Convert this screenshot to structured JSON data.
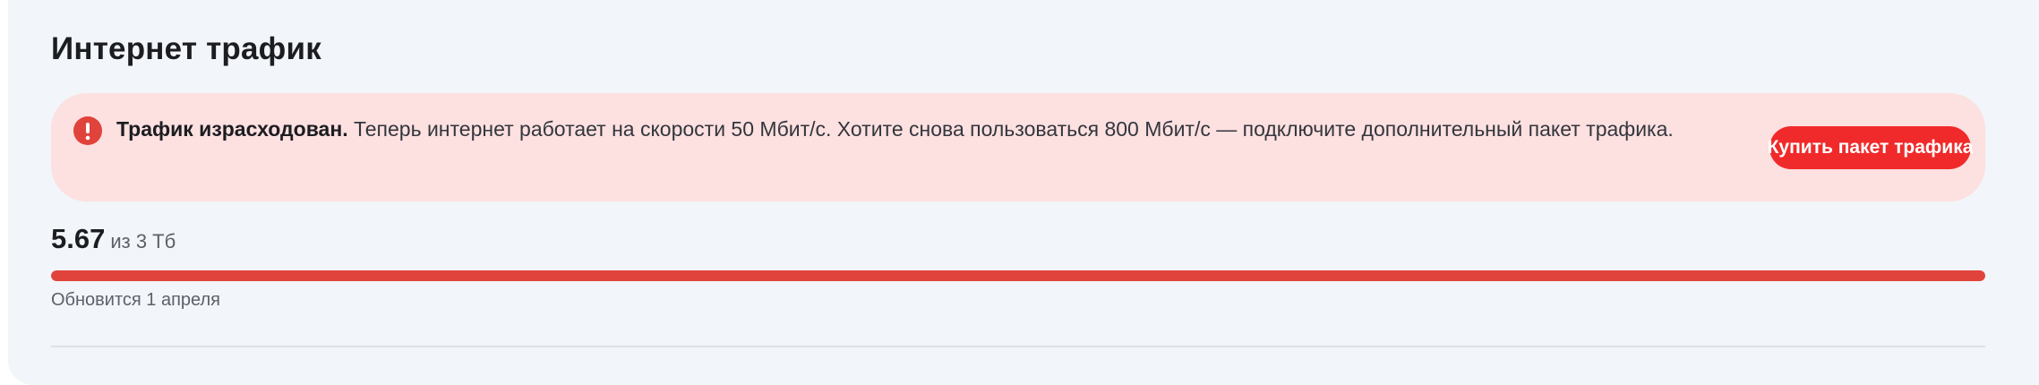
{
  "section": {
    "title": "Интернет трафик"
  },
  "alert": {
    "icon": "exclamation-icon",
    "bold_text": "Трафик израсходован.",
    "message": " Теперь интернет работает на скорости 50 Мбит/с. Хотите снова пользоваться 800 Мбит/с — подключите дополнительный пакет трафика.",
    "button_label": "Купить пакет трафика"
  },
  "usage": {
    "used": "5.67",
    "total_text": "из 3 Тб",
    "progress_percent": 100,
    "renew_text": "Обновится 1 апреля"
  },
  "colors": {
    "accent_red": "#f02a2a",
    "progress_red": "#e0433b",
    "alert_bg": "#fde0e0",
    "card_bg": "#f2f5f9"
  }
}
